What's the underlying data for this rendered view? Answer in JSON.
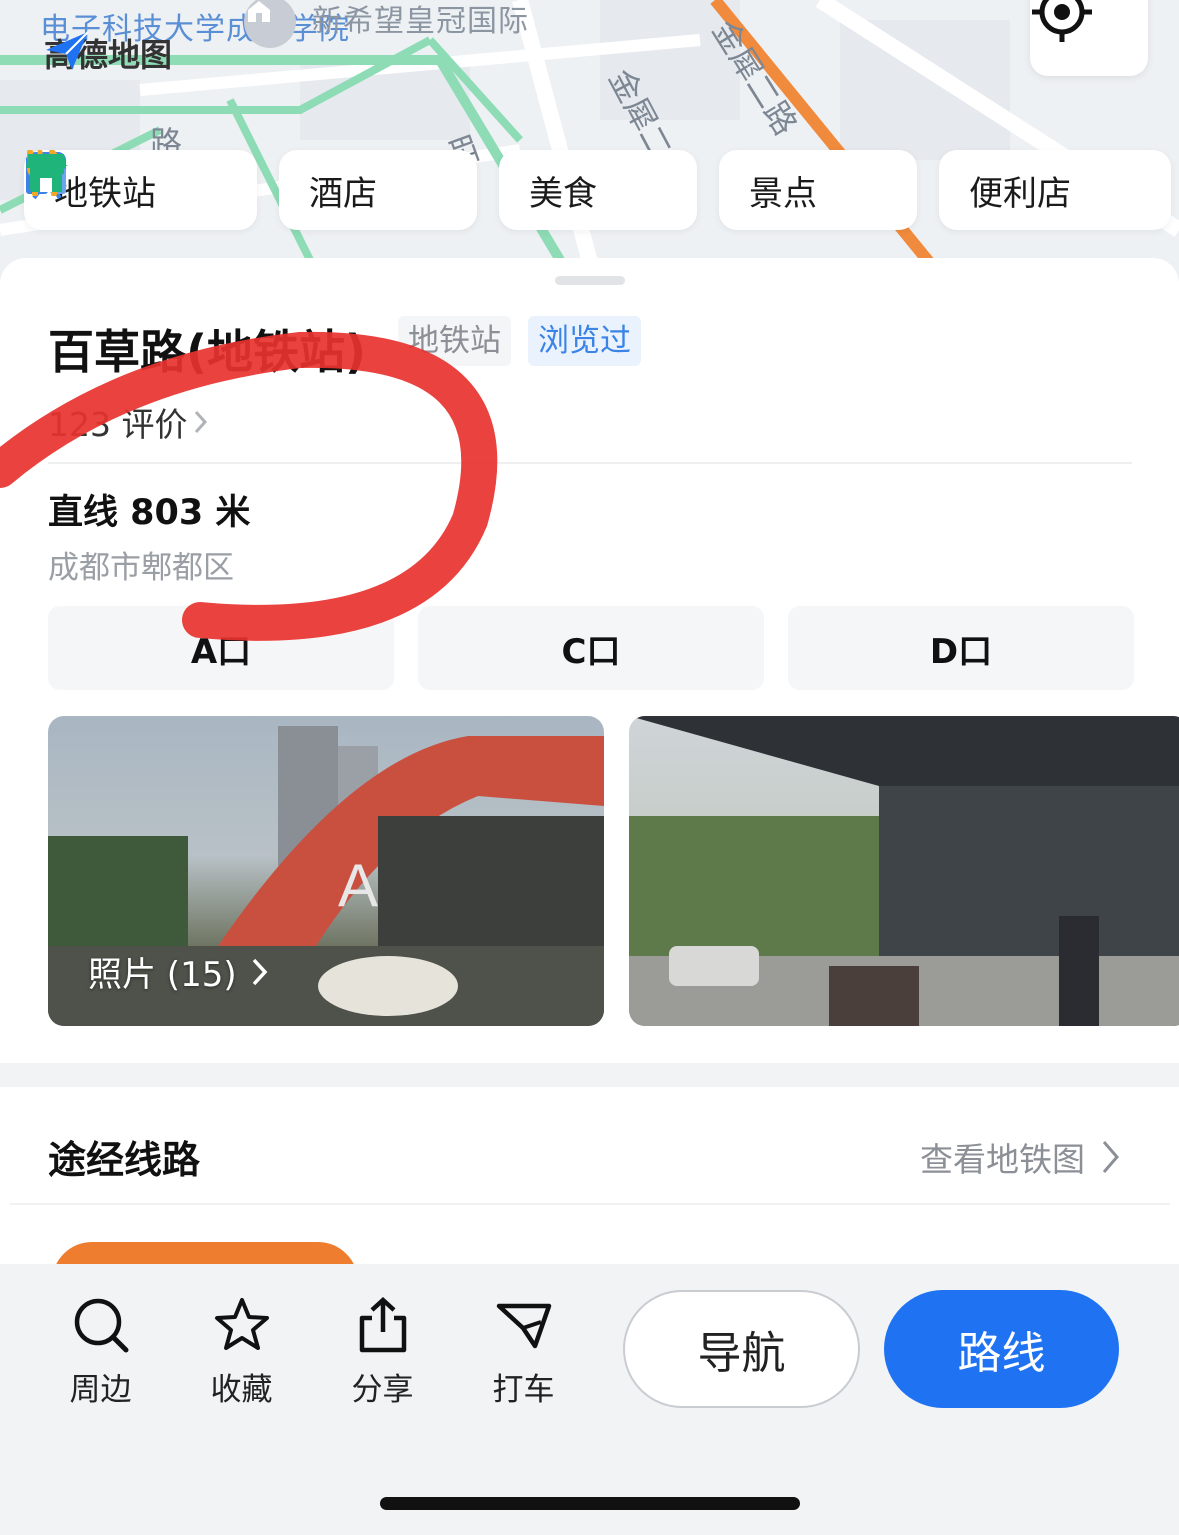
{
  "map": {
    "labels": {
      "poi_top_left": "电子科技大学成都学院",
      "poi_top_center": "新希望皇冠国际",
      "road_vertical": "金犀二路",
      "road_right": "金犀二路",
      "road_left": "路",
      "road_mid": "旺"
    },
    "logo_text": "高德地图",
    "locate_icon": "locate-target-icon",
    "colors": {
      "road_green": "#8ddcb5",
      "metro_orange": "#f08a3c",
      "road_white": "#ffffff"
    }
  },
  "categories": [
    {
      "label": "地铁站",
      "icon": "metro-icon",
      "color": "#3b84e6"
    },
    {
      "label": "酒店",
      "icon": "hotel-icon",
      "color": "#3b84e6"
    },
    {
      "label": "美食",
      "icon": "food-icon",
      "color": "#f5a623"
    },
    {
      "label": "景点",
      "icon": "attraction-icon",
      "color": "#1fb57a"
    },
    {
      "label": "便利店",
      "icon": "store-icon",
      "color": "#1fb57a"
    }
  ],
  "place": {
    "title": "百草路(地铁站)",
    "tag_type": "地铁站",
    "tag_viewed": "浏览过",
    "reviews": "123 评价",
    "distance": "直线 803 米",
    "district": "成都市郫都区",
    "exits": [
      "A口",
      "C口",
      "D口"
    ],
    "photos_caption": "照片 (15)"
  },
  "routes": {
    "title": "途经线路",
    "link": "查看地铁图"
  },
  "bottom": {
    "actions": [
      {
        "label": "周边",
        "icon": "search-icon"
      },
      {
        "label": "收藏",
        "icon": "star-icon"
      },
      {
        "label": "分享",
        "icon": "share-icon"
      },
      {
        "label": "打车",
        "icon": "taxi-icon"
      }
    ],
    "nav_label": "导航",
    "route_label": "路线"
  },
  "colors": {
    "accent": "#1f73f2",
    "annotation_red": "#e8322e",
    "line_orange": "#ee7d2f"
  }
}
